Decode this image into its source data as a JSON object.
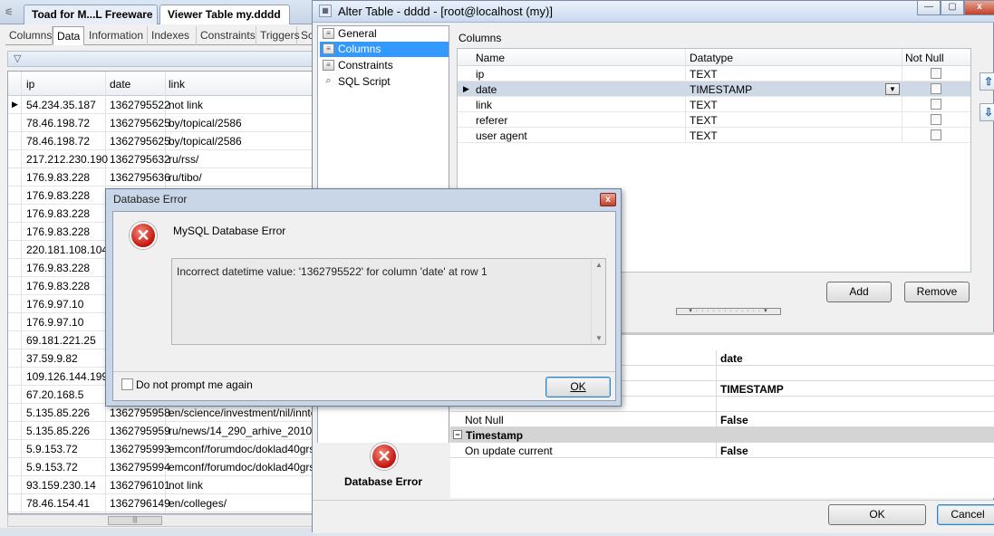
{
  "toad": {
    "doc_tabs": [
      "Toad for M...L Freeware",
      "Viewer Table my.dddd"
    ],
    "sub_tabs": [
      "Columns",
      "Data",
      "Information",
      "Indexes",
      "Constraints",
      "Triggers",
      "Sc"
    ],
    "active_sub_tab": "Data",
    "filter_icon": "funnel-icon",
    "grid": {
      "columns": [
        "ip",
        "date",
        "link"
      ],
      "rows": [
        [
          "54.234.35.187",
          "1362795522",
          "not link"
        ],
        [
          "78.46.198.72",
          "1362795625",
          "by/topical/2586"
        ],
        [
          "78.46.198.72",
          "1362795625",
          "by/topical/2586"
        ],
        [
          "217.212.230.190",
          "1362795632",
          "ru/rss/"
        ],
        [
          "176.9.83.228",
          "1362795636",
          "ru/tibo/"
        ],
        [
          "176.9.83.228",
          "",
          ""
        ],
        [
          "176.9.83.228",
          "",
          ""
        ],
        [
          "176.9.83.228",
          "",
          ""
        ],
        [
          "220.181.108.104",
          "",
          ""
        ],
        [
          "176.9.83.228",
          "",
          ""
        ],
        [
          "176.9.83.228",
          "",
          ""
        ],
        [
          "176.9.97.10",
          "",
          ""
        ],
        [
          "176.9.97.10",
          "",
          ""
        ],
        [
          "69.181.221.25",
          "",
          ""
        ],
        [
          "37.59.9.82",
          "",
          ""
        ],
        [
          "109.126.144.199",
          "",
          ""
        ],
        [
          "67.20.168.5",
          "",
          ""
        ],
        [
          "5.135.85.226",
          "1362795958",
          "en/science/investment/nil/inntek"
        ],
        [
          "5.135.85.226",
          "1362795959",
          "ru/news/14_290_arhive_2010-0"
        ],
        [
          "5.9.153.72",
          "1362795993",
          "emconf/forumdoc/doklad40grsu.d"
        ],
        [
          "5.9.153.72",
          "1362795994",
          "emconf/forumdoc/doklad40grsu.d"
        ],
        [
          "93.159.230.14",
          "1362796101",
          "not link"
        ],
        [
          "78.46.154.41",
          "1362796149",
          "en/colleges/"
        ]
      ]
    }
  },
  "alter": {
    "title": "Alter Table - dddd - [root@localhost (my)]",
    "nav": [
      "General",
      "Columns",
      "Constraints",
      "SQL Script"
    ],
    "nav_selected": "Columns",
    "columns_label": "Columns",
    "column_grid": {
      "headers": [
        "Name",
        "Datatype",
        "Not Null"
      ],
      "rows": [
        {
          "name": "ip",
          "type": "TEXT"
        },
        {
          "name": "date",
          "type": "TIMESTAMP"
        },
        {
          "name": "link",
          "type": "TEXT"
        },
        {
          "name": "referer",
          "type": "TEXT"
        },
        {
          "name": "user agent",
          "type": "TEXT"
        }
      ]
    },
    "add_label": "Add",
    "remove_label": "Remove",
    "props": {
      "name_value": "date",
      "type_value": "TIMESTAMP",
      "not_null_label": "Not Null",
      "not_null_value": "False",
      "category_timestamp": "Timestamp",
      "on_update_label": "On update current",
      "on_update_value": "False"
    },
    "error_panel_label": "Database Error",
    "ok_label": "OK",
    "cancel_label": "Cancel"
  },
  "dialog": {
    "title": "Database Error",
    "close_glyph": "x",
    "heading": "MySQL Database Error",
    "message": "Incorrect datetime value: '1362795522' for column 'date' at row 1",
    "checkbox_label": "Do not prompt me again",
    "ok_label": "OK"
  },
  "colors": {
    "selection": "#3399ff",
    "error_red": "#c4120a"
  }
}
